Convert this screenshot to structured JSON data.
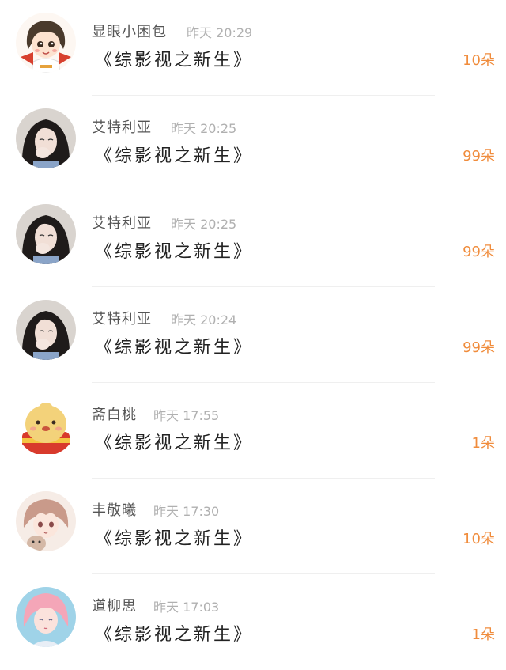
{
  "records": [
    {
      "name": "显眼小困包",
      "time": "昨天 20:29",
      "book": "《综影视之新生》",
      "amount": "10朵",
      "avatar_icon": "cartoon-girl-avatar-icon"
    },
    {
      "name": "艾特利亚",
      "time": "昨天 20:25",
      "book": "《综影视之新生》",
      "amount": "99朵",
      "avatar_icon": "girl-photo-avatar-icon"
    },
    {
      "name": "艾特利亚",
      "time": "昨天 20:25",
      "book": "《综影视之新生》",
      "amount": "99朵",
      "avatar_icon": "girl-photo-avatar-icon"
    },
    {
      "name": "艾特利亚",
      "time": "昨天 20:24",
      "book": "《综影视之新生》",
      "amount": "99朵",
      "avatar_icon": "girl-photo-avatar-icon"
    },
    {
      "name": "斋白桃",
      "time": "昨天 17:55",
      "book": "《综影视之新生》",
      "amount": "1朵",
      "avatar_icon": "cartoon-dumpling-avatar-icon"
    },
    {
      "name": "丰敬曦",
      "time": "昨天 17:30",
      "book": "《综影视之新生》",
      "amount": "10朵",
      "avatar_icon": "anime-boy-avatar-icon"
    },
    {
      "name": "道柳思",
      "time": "昨天 17:03",
      "book": "《综影视之新生》",
      "amount": "1朵",
      "avatar_icon": "pastel-portrait-avatar-icon"
    }
  ],
  "colors": {
    "amount": "#f08c3c",
    "name": "#555555",
    "time": "#b0b0b0",
    "book": "#222222"
  }
}
